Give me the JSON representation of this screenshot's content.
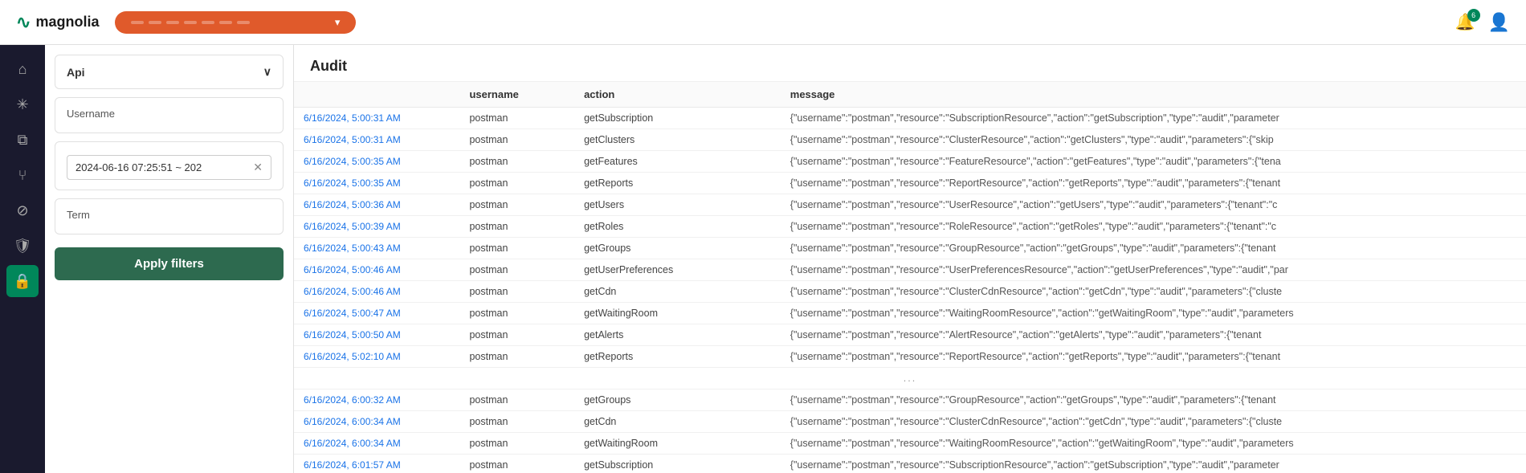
{
  "topbar": {
    "logo_text": "magnolia",
    "nav_pill": {
      "segments": [
        "",
        "",
        "",
        "",
        "",
        "",
        ""
      ],
      "chevron": "▾"
    },
    "notifications_count": "6",
    "notifications_label": "Notifications",
    "user_label": "User"
  },
  "sidebar": {
    "api_section_label": "Api",
    "username_label": "Username",
    "date_range_value": "2024-06-16 07:25:51 ~ 202",
    "term_label": "Term",
    "apply_button_label": "Apply filters"
  },
  "content": {
    "title": "Audit",
    "table": {
      "columns": [
        "username",
        "action",
        "message"
      ],
      "rows": [
        {
          "time": "6/16/2024, 5:00:31 AM",
          "username": "postman",
          "action": "getSubscription",
          "message": "{\"username\":\"postman\",\"resource\":\"SubscriptionResource\",\"action\":\"getSubscription\",\"type\":\"audit\",\"parameter"
        },
        {
          "time": "6/16/2024, 5:00:31 AM",
          "username": "postman",
          "action": "getClusters",
          "message": "{\"username\":\"postman\",\"resource\":\"ClusterResource\",\"action\":\"getClusters\",\"type\":\"audit\",\"parameters\":{\"skip"
        },
        {
          "time": "6/16/2024, 5:00:35 AM",
          "username": "postman",
          "action": "getFeatures",
          "message": "{\"username\":\"postman\",\"resource\":\"FeatureResource\",\"action\":\"getFeatures\",\"type\":\"audit\",\"parameters\":{\"tena"
        },
        {
          "time": "6/16/2024, 5:00:35 AM",
          "username": "postman",
          "action": "getReports",
          "message": "{\"username\":\"postman\",\"resource\":\"ReportResource\",\"action\":\"getReports\",\"type\":\"audit\",\"parameters\":{\"tenant"
        },
        {
          "time": "6/16/2024, 5:00:36 AM",
          "username": "postman",
          "action": "getUsers",
          "message": "{\"username\":\"postman\",\"resource\":\"UserResource\",\"action\":\"getUsers\",\"type\":\"audit\",\"parameters\":{\"tenant\":\"c"
        },
        {
          "time": "6/16/2024, 5:00:39 AM",
          "username": "postman",
          "action": "getRoles",
          "message": "{\"username\":\"postman\",\"resource\":\"RoleResource\",\"action\":\"getRoles\",\"type\":\"audit\",\"parameters\":{\"tenant\":\"c"
        },
        {
          "time": "6/16/2024, 5:00:43 AM",
          "username": "postman",
          "action": "getGroups",
          "message": "{\"username\":\"postman\",\"resource\":\"GroupResource\",\"action\":\"getGroups\",\"type\":\"audit\",\"parameters\":{\"tenant"
        },
        {
          "time": "6/16/2024, 5:00:46 AM",
          "username": "postman",
          "action": "getUserPreferences",
          "message": "{\"username\":\"postman\",\"resource\":\"UserPreferencesResource\",\"action\":\"getUserPreferences\",\"type\":\"audit\",\"par"
        },
        {
          "time": "6/16/2024, 5:00:46 AM",
          "username": "postman",
          "action": "getCdn",
          "message": "{\"username\":\"postman\",\"resource\":\"ClusterCdnResource\",\"action\":\"getCdn\",\"type\":\"audit\",\"parameters\":{\"cluste"
        },
        {
          "time": "6/16/2024, 5:00:47 AM",
          "username": "postman",
          "action": "getWaitingRoom",
          "message": "{\"username\":\"postman\",\"resource\":\"WaitingRoomResource\",\"action\":\"getWaitingRoom\",\"type\":\"audit\",\"parameters"
        },
        {
          "time": "6/16/2024, 5:00:50 AM",
          "username": "postman",
          "action": "getAlerts",
          "message": "{\"username\":\"postman\",\"resource\":\"AlertResource\",\"action\":\"getAlerts\",\"type\":\"audit\",\"parameters\":{\"tenant"
        },
        {
          "time": "6/16/2024, 5:02:10 AM",
          "username": "postman",
          "action": "getReports",
          "message": "{\"username\":\"postman\",\"resource\":\"ReportResource\",\"action\":\"getReports\",\"type\":\"audit\",\"parameters\":{\"tenant"
        },
        {
          "time": "...",
          "username": "",
          "action": "",
          "message": ""
        },
        {
          "time": "6/16/2024, 6:00:32 AM",
          "username": "postman",
          "action": "getGroups",
          "message": "{\"username\":\"postman\",\"resource\":\"GroupResource\",\"action\":\"getGroups\",\"type\":\"audit\",\"parameters\":{\"tenant"
        },
        {
          "time": "6/16/2024, 6:00:34 AM",
          "username": "postman",
          "action": "getCdn",
          "message": "{\"username\":\"postman\",\"resource\":\"ClusterCdnResource\",\"action\":\"getCdn\",\"type\":\"audit\",\"parameters\":{\"cluste"
        },
        {
          "time": "6/16/2024, 6:00:34 AM",
          "username": "postman",
          "action": "getWaitingRoom",
          "message": "{\"username\":\"postman\",\"resource\":\"WaitingRoomResource\",\"action\":\"getWaitingRoom\",\"type\":\"audit\",\"parameters"
        },
        {
          "time": "6/16/2024, 6:01:57 AM",
          "username": "postman",
          "action": "getSubscription",
          "message": "{\"username\":\"postman\",\"resource\":\"SubscriptionResource\",\"action\":\"getSubscription\",\"type\":\"audit\",\"parameter"
        }
      ]
    }
  },
  "rail_icons": [
    {
      "name": "home",
      "symbol": "⌂",
      "active": false
    },
    {
      "name": "asterisk",
      "symbol": "✳",
      "active": false
    },
    {
      "name": "layers",
      "symbol": "❑",
      "active": false
    },
    {
      "name": "branch",
      "symbol": "⑂",
      "active": false
    },
    {
      "name": "ban",
      "symbol": "⊘",
      "active": false
    },
    {
      "name": "shield",
      "symbol": "🛡",
      "active": false
    },
    {
      "name": "lock",
      "symbol": "🔒",
      "active": true
    }
  ]
}
